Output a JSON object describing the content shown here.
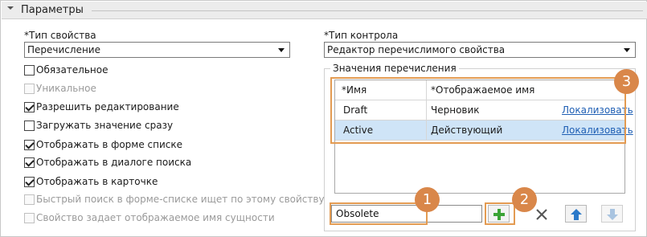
{
  "panel": {
    "title": "Параметры"
  },
  "left": {
    "property_type_label": "*Тип свойства",
    "property_type_value": "Перечисление",
    "checkboxes": [
      {
        "label": "Обязательное",
        "checked": false,
        "disabled": false
      },
      {
        "label": "Уникальное",
        "checked": false,
        "disabled": true
      },
      {
        "label": "Разрешить редактирование",
        "checked": true,
        "disabled": false
      },
      {
        "label": "Загружать значение сразу",
        "checked": false,
        "disabled": false
      },
      {
        "label": "Отображать в форме списке",
        "checked": true,
        "disabled": false
      },
      {
        "label": "Отображать в диалоге поиска",
        "checked": true,
        "disabled": false
      },
      {
        "label": "Отображать в карточке",
        "checked": true,
        "disabled": false
      },
      {
        "label": "Быстрый поиск в форме-списке ищет по этому свойству",
        "checked": false,
        "disabled": true
      },
      {
        "label": "Свойство задает отображаемое имя сущности",
        "checked": false,
        "disabled": true
      }
    ]
  },
  "right": {
    "control_type_label": "*Тип контрола",
    "control_type_value": "Редактор перечислимого свойства",
    "group_title": "Значения перечисления",
    "grid": {
      "columns": [
        "*Имя",
        "*Отображаемое имя"
      ],
      "rows": [
        {
          "name": "Draft",
          "display": "Черновик",
          "action": "Локализовать",
          "selected": false
        },
        {
          "name": "Active",
          "display": "Действующий",
          "action": "Локализовать",
          "selected": true
        }
      ]
    },
    "new_value": "Obsolete",
    "buttons": {
      "add": "plus-icon",
      "remove": "close-icon",
      "move_up": "arrow-up-icon",
      "move_down": "arrow-down-icon"
    }
  },
  "callouts": [
    "1",
    "2",
    "3"
  ],
  "colors": {
    "accent_orange": "#d9874a",
    "selection_blue": "#cfe4f7",
    "add_green": "#3aa335",
    "arrow_blue": "#2b79c9"
  }
}
